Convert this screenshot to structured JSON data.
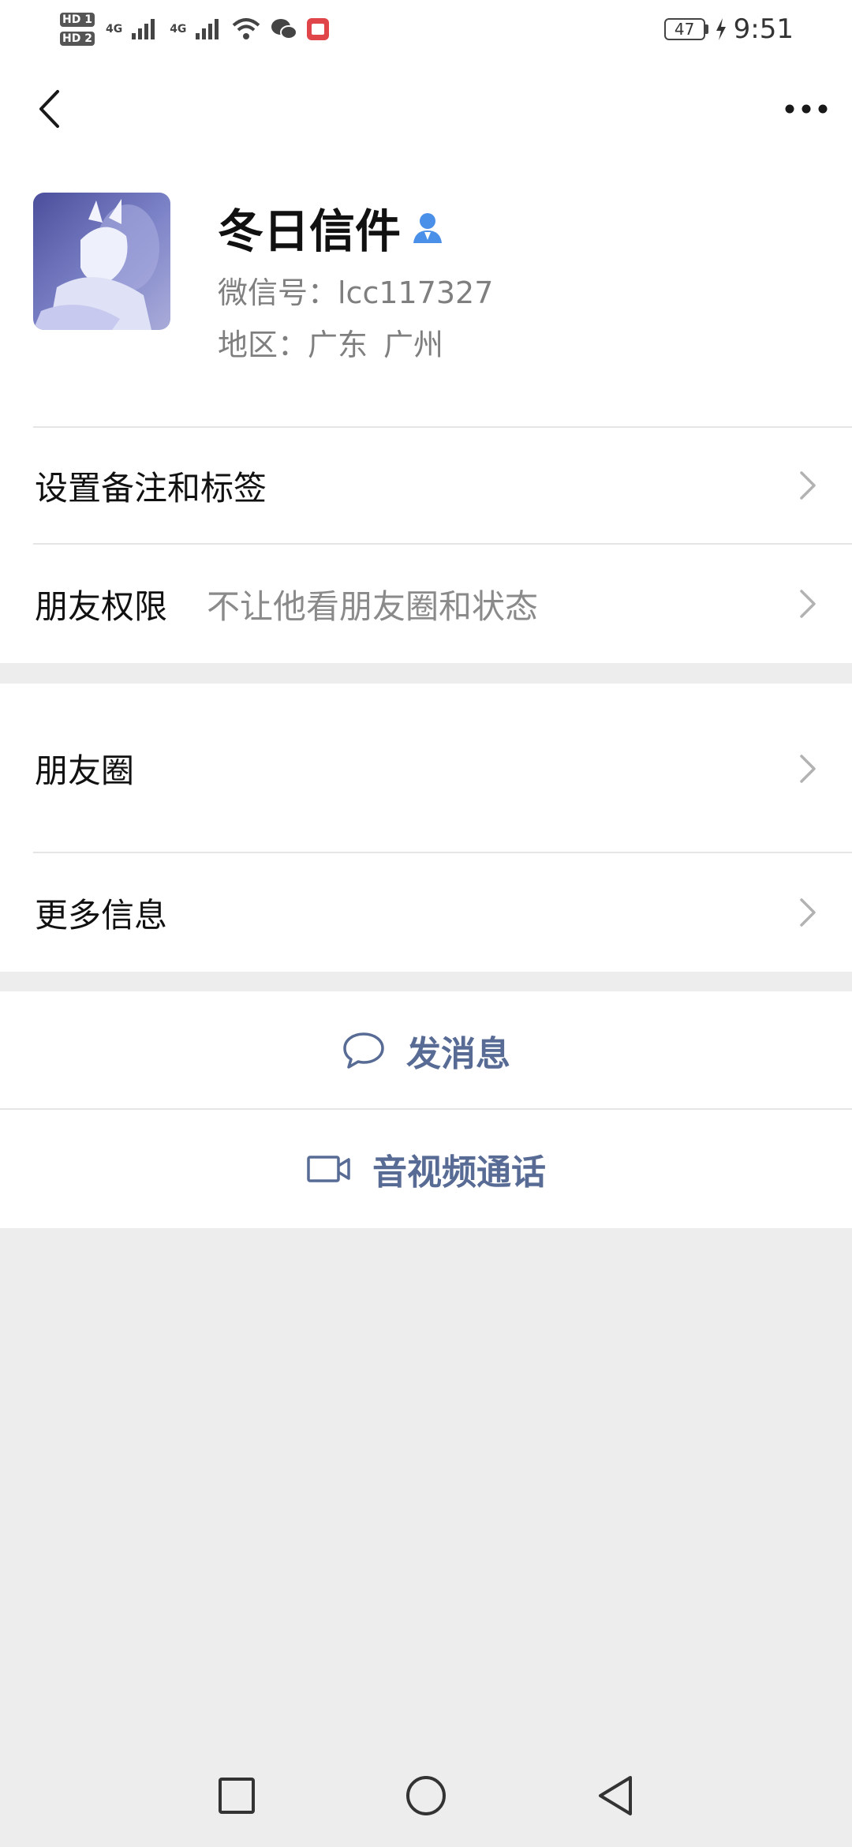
{
  "status_bar": {
    "sim1": "HD 1",
    "sim2": "HD 2",
    "net1": "4G",
    "net2": "4G",
    "battery": "47",
    "time": "9:51",
    "icons": [
      "signal-icon",
      "wifi-icon",
      "wechat-icon",
      "book-app-icon",
      "charging-icon"
    ]
  },
  "header": {
    "back_icon": "back-chevron-icon",
    "more_icon": "more-dots-icon"
  },
  "profile": {
    "nickname": "冬日信件",
    "gender_icon": "person-icon",
    "wechat_id": "微信号：lcc117327",
    "region_label": "地区：",
    "region_province": "广东",
    "region_city": "广州"
  },
  "settings": {
    "remark_label": "设置备注和标签",
    "permission_label": "朋友权限",
    "permission_value": "不让他看朋友圈和状态"
  },
  "moments": {
    "moments_label": "朋友圈",
    "more_info_label": "更多信息"
  },
  "actions": {
    "message_label": "发消息",
    "call_label": "音视频通话"
  },
  "colors": {
    "link": "#576b95",
    "background": "#ededed",
    "accent_icon": "#4a8fe8"
  }
}
